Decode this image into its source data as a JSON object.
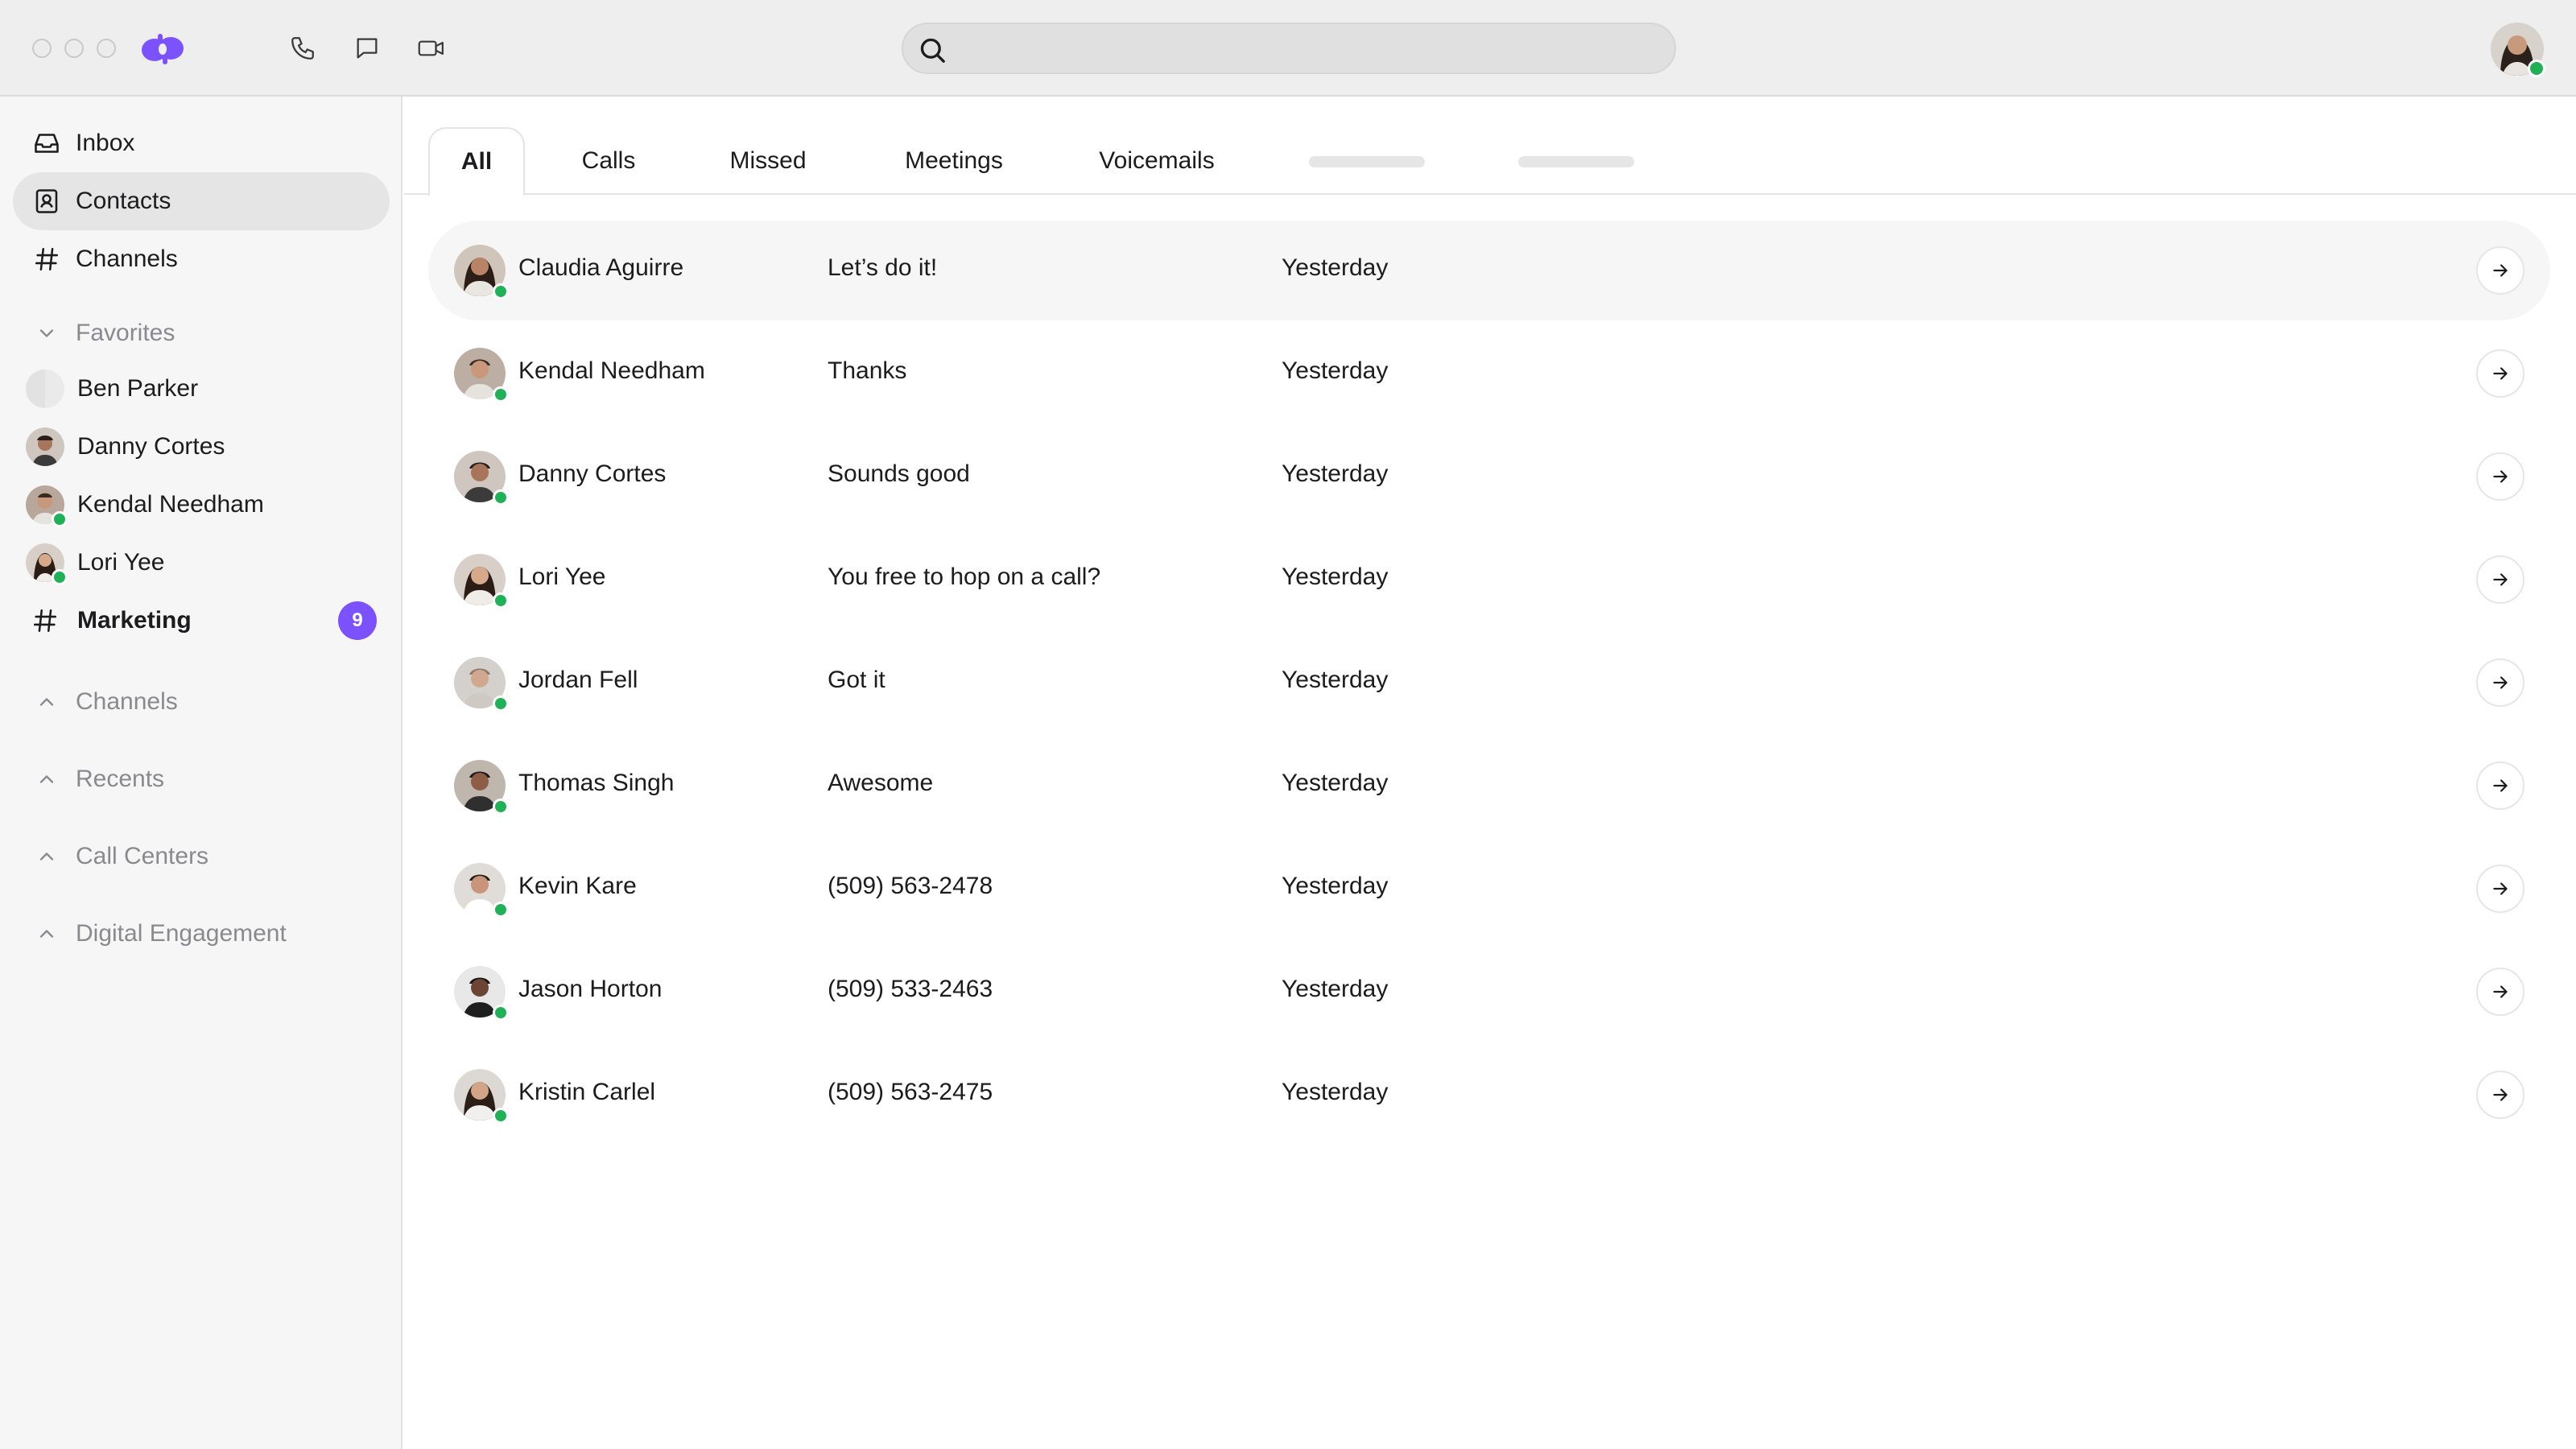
{
  "titlebar": {
    "search_placeholder": "",
    "icons": [
      "phone-icon",
      "chat-icon",
      "video-icon",
      "search-icon"
    ]
  },
  "sidebar": {
    "nav": [
      {
        "label": "Inbox",
        "icon": "inbox-icon"
      },
      {
        "label": "Contacts",
        "icon": "contacts-icon",
        "active": true
      },
      {
        "label": "Channels",
        "icon": "hash-icon"
      }
    ],
    "favorites": {
      "title": "Favorites",
      "items": [
        {
          "label": "Ben Parker",
          "online": false
        },
        {
          "label": "Danny Cortes",
          "online": false
        },
        {
          "label": "Kendal Needham",
          "online": true
        },
        {
          "label": "Lori Yee",
          "online": true
        },
        {
          "label": "Marketing",
          "type": "channel",
          "badge": "9"
        }
      ]
    },
    "sections": [
      {
        "label": "Channels"
      },
      {
        "label": "Recents"
      },
      {
        "label": "Call Centers"
      },
      {
        "label": "Digital Engagement"
      }
    ]
  },
  "tabs": [
    {
      "label": "All",
      "active": true
    },
    {
      "label": "Calls"
    },
    {
      "label": "Missed"
    },
    {
      "label": "Meetings"
    },
    {
      "label": "Voicemails"
    }
  ],
  "contacts": [
    {
      "name": "Claudia Aguirre",
      "message": "Let’s do it!",
      "time": "Yesterday"
    },
    {
      "name": "Kendal Needham",
      "message": "Thanks",
      "time": "Yesterday"
    },
    {
      "name": "Danny Cortes",
      "message": "Sounds good",
      "time": "Yesterday"
    },
    {
      "name": "Lori Yee",
      "message": "You free to hop on a call?",
      "time": "Yesterday"
    },
    {
      "name": "Jordan Fell",
      "message": "Got it",
      "time": "Yesterday"
    },
    {
      "name": "Thomas Singh",
      "message": "Awesome",
      "time": "Yesterday"
    },
    {
      "name": "Kevin Kare",
      "message": "(509) 563-2478",
      "time": "Yesterday"
    },
    {
      "name": "Jason Horton",
      "message": "(509) 533-2463",
      "time": "Yesterday"
    },
    {
      "name": "Kristin Carlel",
      "message": "(509) 563-2475",
      "time": "Yesterday"
    }
  ],
  "colors": {
    "accent": "#7c52ff",
    "presence": "#1fb155"
  }
}
